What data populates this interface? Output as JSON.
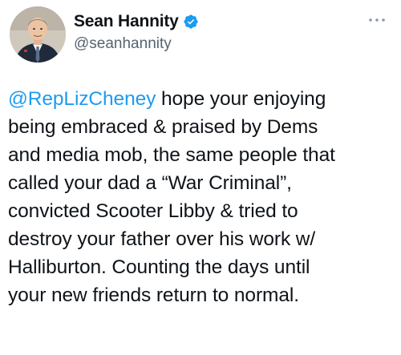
{
  "tweet": {
    "author": {
      "display_name": "Sean Hannity",
      "handle": "@seanhannity",
      "verified": true,
      "avatar_icon": "profile-photo"
    },
    "more_icon": "more-options-icon",
    "text": {
      "mention": "@RepLizCheney",
      "line1_rest": " hope your enjoying",
      "line2": "being embraced & praised by Dems",
      "line3": "and media mob, the same people that",
      "line4": "called your dad a “War Criminal”,",
      "line5": "convicted Scooter Libby & tried to",
      "line6": "destroy your father over his work w/",
      "line7": "Halliburton. Counting the days until",
      "line8": "your new friends return to normal."
    }
  },
  "colors": {
    "link": "#1d9bf0",
    "verified_badge": "#1d9bf0",
    "text": "#0f1419",
    "secondary_text": "#536471"
  }
}
